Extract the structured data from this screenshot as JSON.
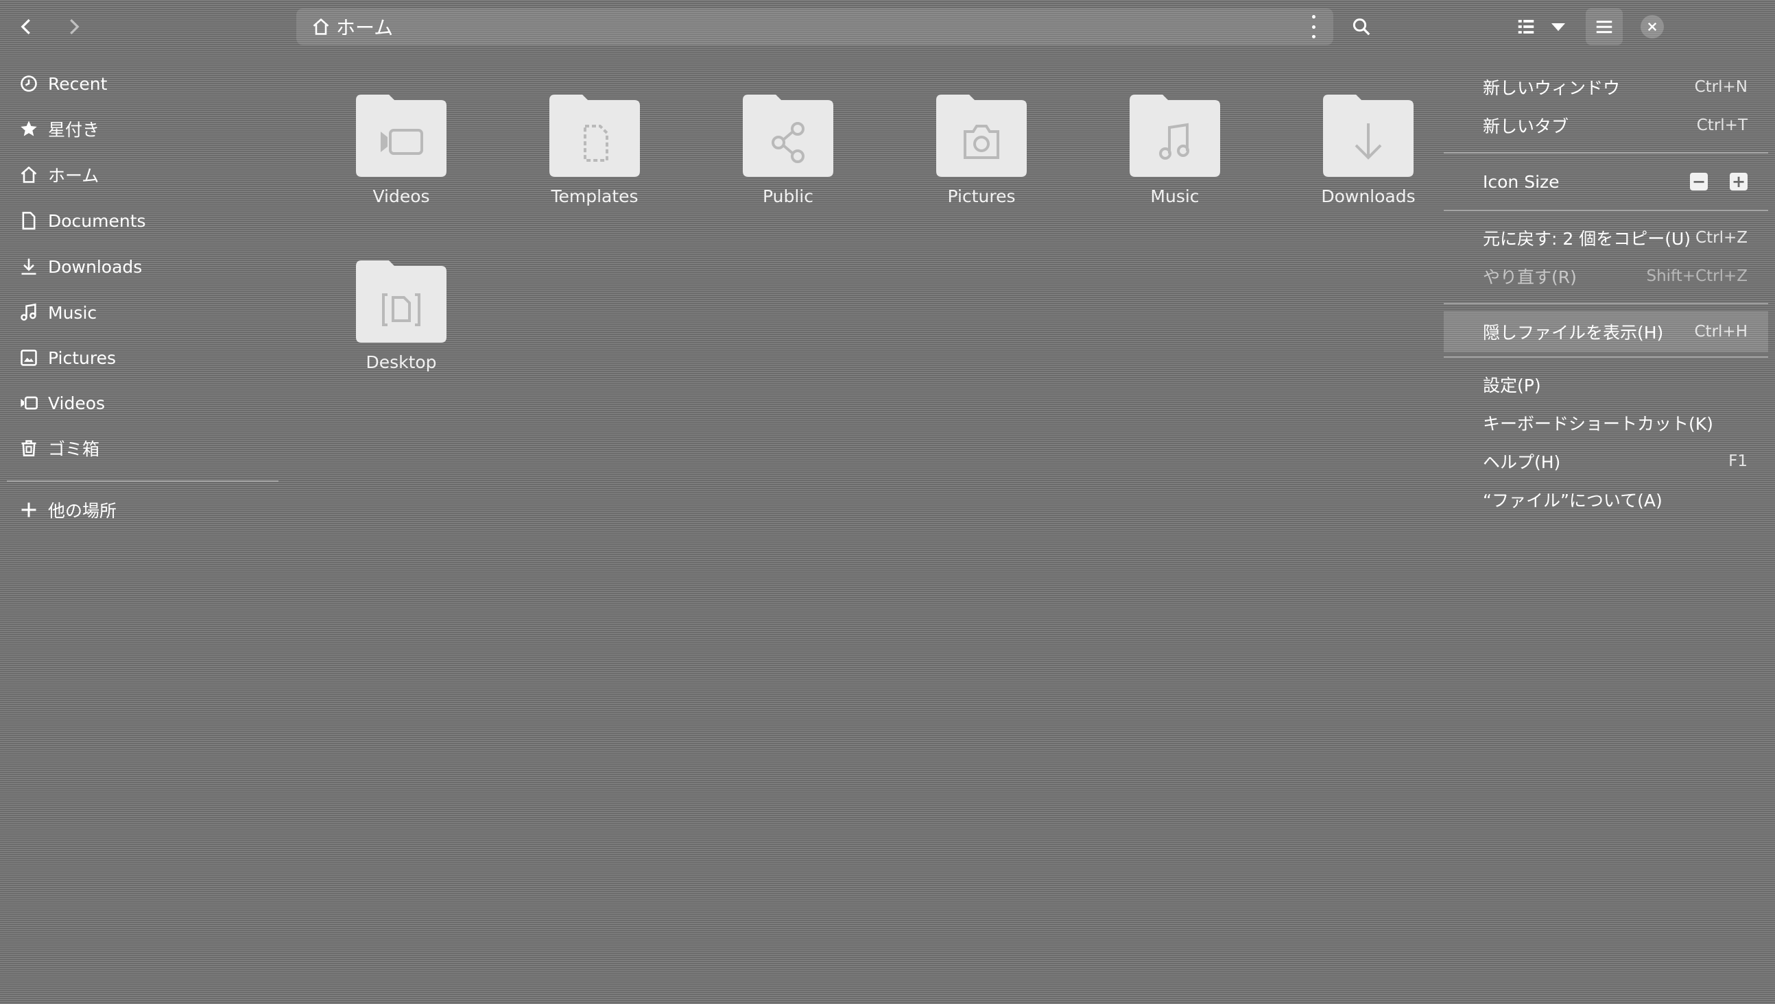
{
  "header": {
    "back_icon": "chevron-left-icon",
    "forward_icon": "chevron-right-icon",
    "path_label": "ホーム",
    "path_icon": "home-icon",
    "search_icon": "search-icon",
    "view_icon": "list-view-icon",
    "view_dropdown_icon": "caret-down-icon",
    "menu_icon": "hamburger-icon",
    "close_icon": "close-icon"
  },
  "sidebar": {
    "items": [
      {
        "label": "Recent",
        "icon": "clock-icon"
      },
      {
        "label": "星付き",
        "icon": "star-icon"
      },
      {
        "label": "ホーム",
        "icon": "home-icon"
      },
      {
        "label": "Documents",
        "icon": "document-icon"
      },
      {
        "label": "Downloads",
        "icon": "download-icon"
      },
      {
        "label": "Music",
        "icon": "music-icon"
      },
      {
        "label": "Pictures",
        "icon": "picture-icon"
      },
      {
        "label": "Videos",
        "icon": "video-icon"
      },
      {
        "label": "ゴミ箱",
        "icon": "trash-icon"
      }
    ],
    "other_locations": {
      "label": "他の場所",
      "icon": "plus-icon"
    }
  },
  "folders": [
    {
      "label": "Videos",
      "icon": "video-icon"
    },
    {
      "label": "Templates",
      "icon": "template-icon"
    },
    {
      "label": "Public",
      "icon": "share-icon"
    },
    {
      "label": "Pictures",
      "icon": "camera-icon"
    },
    {
      "label": "Music",
      "icon": "music-icon"
    },
    {
      "label": "Downloads",
      "icon": "download-icon"
    },
    {
      "label": "Desktop",
      "icon": "desktop-icon"
    }
  ],
  "menu": {
    "new_window": {
      "label": "新しいウィンドウ",
      "accel": "Ctrl+N"
    },
    "new_tab": {
      "label": "新しいタブ",
      "accel": "Ctrl+T"
    },
    "icon_size": {
      "label": "Icon Size",
      "zoom_out": "−",
      "zoom_in": "+"
    },
    "undo": {
      "label": "元に戻す: 2 個をコピー(U)",
      "accel": "Ctrl+Z"
    },
    "redo": {
      "label": "やり直す(R)",
      "accel": "Shift+Ctrl+Z"
    },
    "show_hidden": {
      "label": "隠しファイルを表示(H)",
      "accel": "Ctrl+H"
    },
    "preferences": {
      "label": "設定(P)"
    },
    "shortcuts": {
      "label": "キーボードショートカット(K)"
    },
    "help": {
      "label": "ヘルプ(H)",
      "accel": "F1"
    },
    "about": {
      "label": "“ファイル”について(A)"
    }
  }
}
